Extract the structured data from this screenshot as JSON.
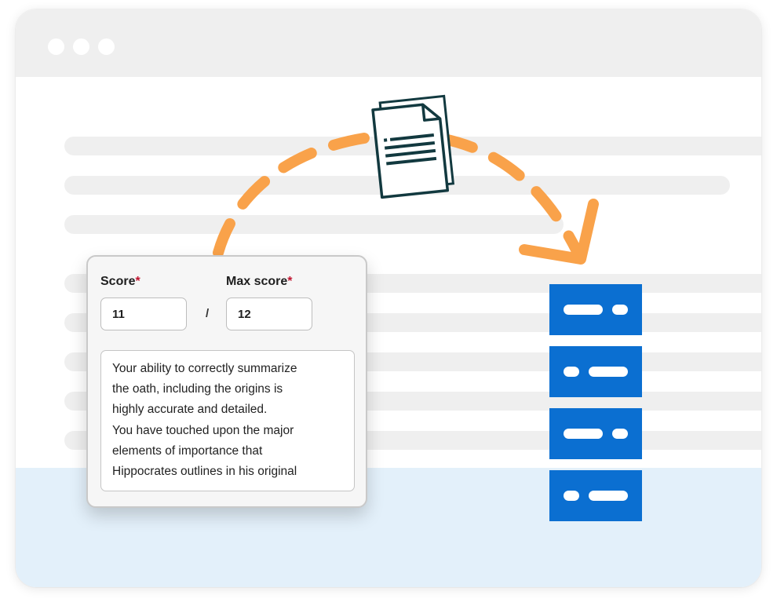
{
  "window": {
    "controls": [
      "window-dot",
      "window-dot",
      "window-dot"
    ]
  },
  "illustration": {
    "arrow_color": "#f9a24a",
    "document_icon": "document-icon",
    "server_color": "#0b6fd1",
    "server_blocks": 4
  },
  "grading_panel": {
    "score_label": "Score",
    "max_score_label": "Max score",
    "required_marker": "*",
    "score_value": "11",
    "separator": "/",
    "max_score_value": "12",
    "feedback_text": "Your ability to correctly summarize\nthe oath, including the origins is\nhighly accurate and detailed.\nYou have touched upon the major\nelements of importance that\nHippocrates outlines in his original"
  }
}
